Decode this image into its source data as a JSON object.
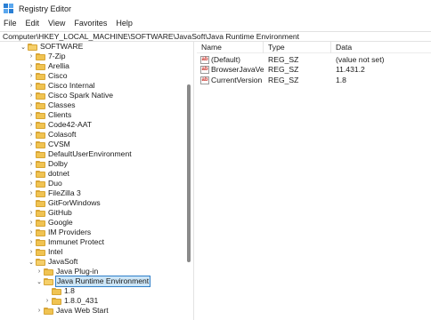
{
  "window": {
    "title": "Registry Editor"
  },
  "menu": [
    "File",
    "Edit",
    "View",
    "Favorites",
    "Help"
  ],
  "address": "Computer\\HKEY_LOCAL_MACHINE\\SOFTWARE\\JavaSoft\\Java Runtime Environment",
  "tree": {
    "items": [
      {
        "label": "SOFTWARE",
        "expanded": true
      },
      {
        "label": "7-Zip"
      },
      {
        "label": "Arellia"
      },
      {
        "label": "Cisco"
      },
      {
        "label": "Cisco Internal"
      },
      {
        "label": "Cisco Spark Native"
      },
      {
        "label": "Classes"
      },
      {
        "label": "Clients"
      },
      {
        "label": "Code42-AAT"
      },
      {
        "label": "Colasoft"
      },
      {
        "label": "CVSM"
      },
      {
        "label": "DefaultUserEnvironment"
      },
      {
        "label": "Dolby"
      },
      {
        "label": "dotnet"
      },
      {
        "label": "Duo"
      },
      {
        "label": "FileZilla 3"
      },
      {
        "label": "GitForWindows"
      },
      {
        "label": "GitHub"
      },
      {
        "label": "Google"
      },
      {
        "label": "IM Providers"
      },
      {
        "label": "Immunet Protect"
      },
      {
        "label": "Intel"
      },
      {
        "label": "JavaSoft",
        "expanded": true
      },
      {
        "label": "Java Plug-in"
      },
      {
        "label": "Java Runtime Environment",
        "expanded": true,
        "selected": true
      },
      {
        "label": "1.8"
      },
      {
        "label": "1.8.0_431"
      },
      {
        "label": "Java Web Start"
      }
    ]
  },
  "list": {
    "headers": {
      "name": "Name",
      "type": "Type",
      "data": "Data"
    },
    "rows": [
      {
        "name": "(Default)",
        "type": "REG_SZ",
        "data": "(value not set)",
        "icon": "string-value-icon"
      },
      {
        "name": "BrowserJavaVersi...",
        "type": "REG_SZ",
        "data": "11.431.2",
        "icon": "string-value-icon"
      },
      {
        "name": "CurrentVersion",
        "type": "REG_SZ",
        "data": "1.8",
        "icon": "string-value-icon"
      }
    ]
  },
  "colors": {
    "folder": "#f0c352",
    "selection": "#cde6f7",
    "selection_border": "#2f7fc9",
    "string_icon_text": "#c8322a"
  }
}
